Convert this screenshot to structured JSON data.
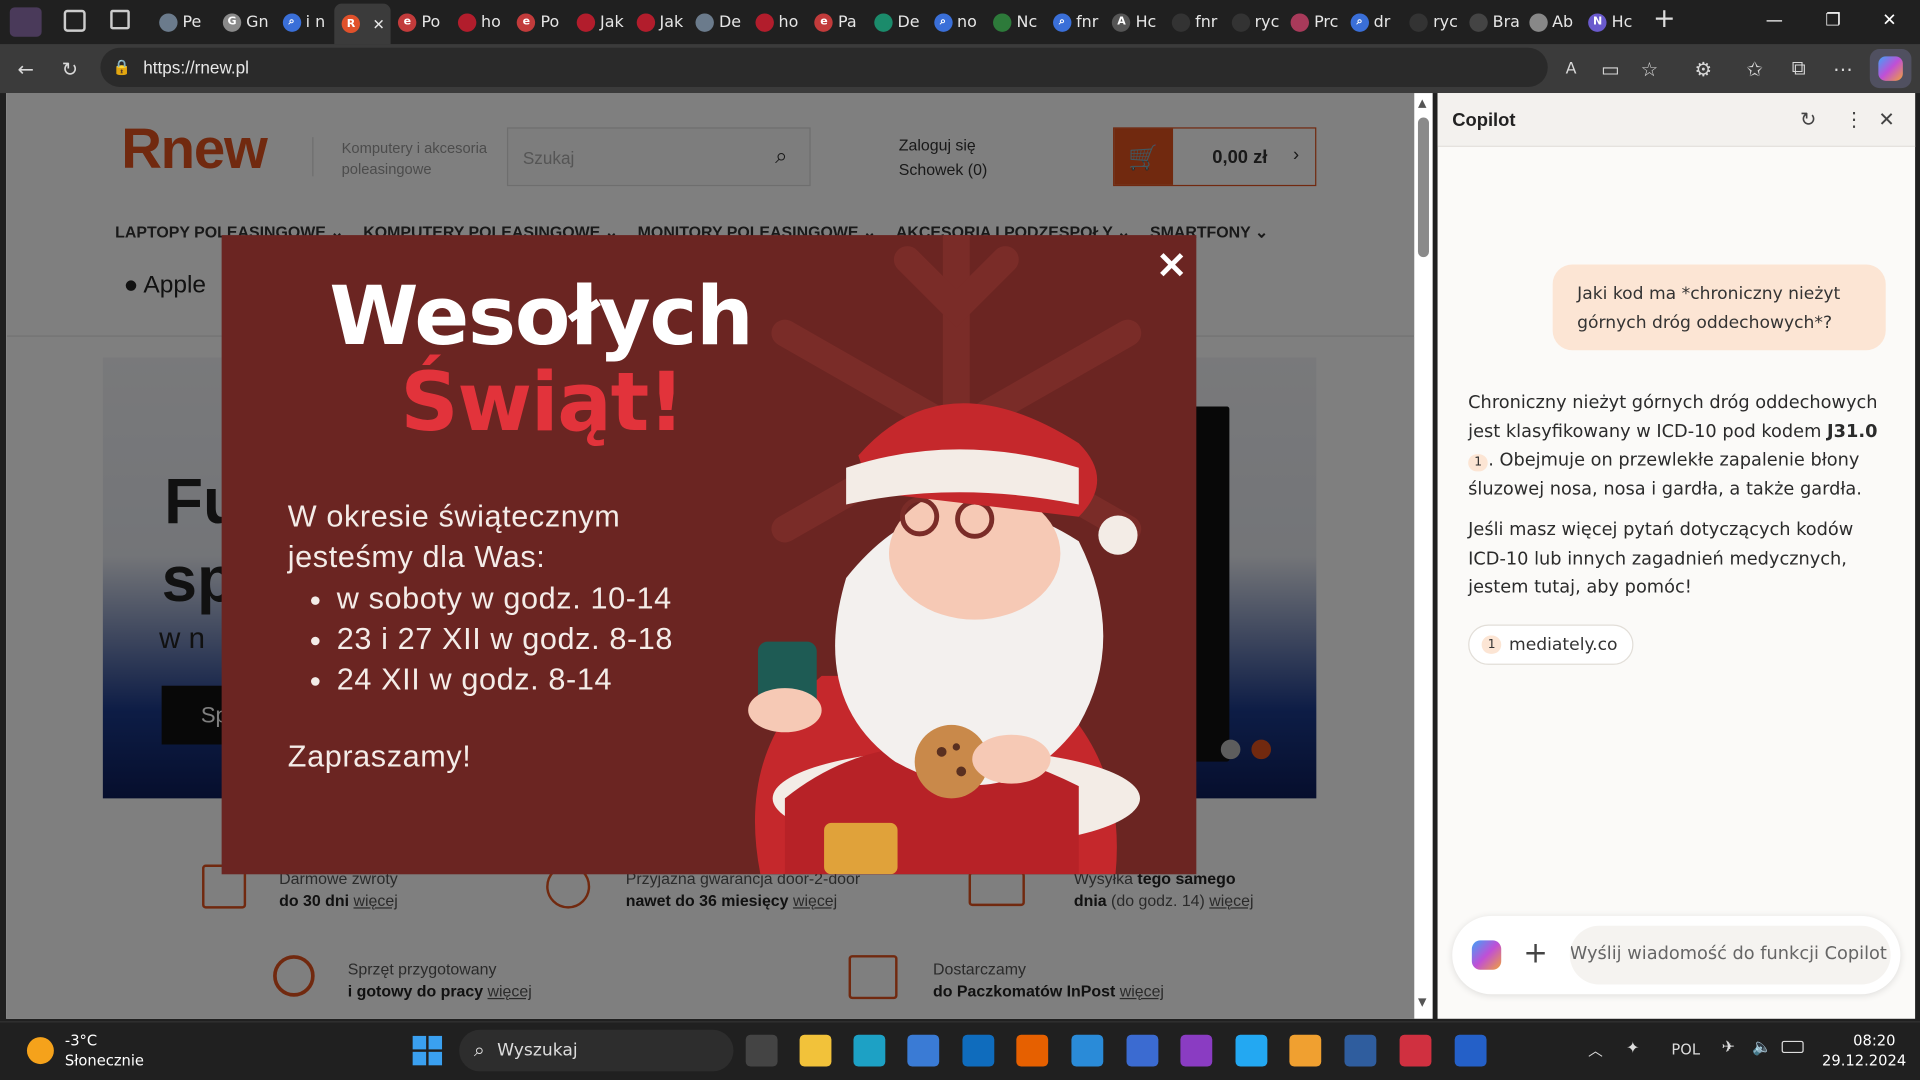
{
  "browser": {
    "tabs": [
      {
        "title": "Pe",
        "color": "#6b7b8c",
        "glyph": ""
      },
      {
        "title": "Gn",
        "color": "#8a8a8a",
        "glyph": "G"
      },
      {
        "title": "i n",
        "color": "#3a6fd8",
        "glyph": "⌕"
      },
      {
        "title": "",
        "color": "#e0512b",
        "glyph": "R",
        "active": true
      },
      {
        "title": "Po",
        "color": "#c23b3b",
        "glyph": "e"
      },
      {
        "title": "ho",
        "color": "#b21d2c",
        "glyph": ""
      },
      {
        "title": "Po",
        "color": "#c23b3b",
        "glyph": "e"
      },
      {
        "title": "Jak",
        "color": "#b21d2c",
        "glyph": ""
      },
      {
        "title": "Jak",
        "color": "#b21d2c",
        "glyph": ""
      },
      {
        "title": "De",
        "color": "#6b7b8c",
        "glyph": ""
      },
      {
        "title": "ho",
        "color": "#b21d2c",
        "glyph": ""
      },
      {
        "title": "Pa",
        "color": "#c23b3b",
        "glyph": "e"
      },
      {
        "title": "De",
        "color": "#1b8b6b",
        "glyph": ""
      },
      {
        "title": "no",
        "color": "#3a6fd8",
        "glyph": "⌕"
      },
      {
        "title": "Nc",
        "color": "#2d7a3a",
        "glyph": ""
      },
      {
        "title": "fnr",
        "color": "#3a6fd8",
        "glyph": "⌕"
      },
      {
        "title": "Hc",
        "color": "#555555",
        "glyph": "A"
      },
      {
        "title": "fnr",
        "color": "#333333",
        "glyph": ""
      },
      {
        "title": "ryc",
        "color": "#333333",
        "glyph": ""
      },
      {
        "title": "Prc",
        "color": "#a83a5a",
        "glyph": ""
      },
      {
        "title": "dr",
        "color": "#3a6fd8",
        "glyph": "⌕"
      },
      {
        "title": "ryc",
        "color": "#333333",
        "glyph": ""
      },
      {
        "title": "Bra",
        "color": "#444444",
        "glyph": ""
      },
      {
        "title": "Ab",
        "color": "#888888",
        "glyph": ""
      },
      {
        "title": "Hc",
        "color": "#6a5acd",
        "glyph": "N"
      }
    ],
    "url": "https://rnew.pl"
  },
  "site": {
    "logo": "Rnew",
    "tagline_1": "Komputery i akcesoria",
    "tagline_2": "poleasingowe",
    "search_placeholder": "Szukaj",
    "login": "Zaloguj się",
    "clipboard": "Schowek (0)",
    "cart_total": "0,00 zł",
    "nav": [
      "LAPTOPY POLEASINGOWE",
      "KOMPUTERY POLEASINGOWE",
      "MONITORY POLEASINGOWE",
      "AKCESORIA I PODZESPOŁY",
      "SMARTFONY"
    ],
    "brand": "Apple",
    "banner_text_1": "Fu",
    "banner_text_2": "sp",
    "banner_text_3": "w n",
    "banner_button": "Sp",
    "features": [
      {
        "line1": "Darmowe zwroty",
        "line2_bold": "do 30 dni",
        "link": "więcej"
      },
      {
        "line1": "Przyjazna gwarancja door-2-door",
        "line2_bold": "nawet do 36 miesięcy",
        "link": "więcej"
      },
      {
        "line1_pre": "Wysyłka ",
        "line1_bold": "tego samego",
        "line2_bold": "dnia",
        "line2": " (do godz. 14)",
        "link": "więcej"
      },
      {
        "line1": "Sprzęt przygotowany",
        "line2_bold": "i gotowy do pracy",
        "link": "więcej"
      },
      {
        "line1": "Dostarczamy",
        "line2_bold": "do Paczkomatów InPost",
        "link": "więcej"
      }
    ]
  },
  "popup": {
    "title_1": "Wesołych",
    "title_2": "Świąt!",
    "intro_1": "W okresie świątecznym",
    "intro_2": "jesteśmy dla Was:",
    "hours": [
      "w soboty w godz. 10-14",
      "23 i 27 XII w godz. 8-18",
      "24 XII w godz. 8-14"
    ],
    "closing": "Zapraszamy!",
    "close": "✕"
  },
  "copilot": {
    "title": "Copilot",
    "user_message": "Jaki kod ma *chroniczny nieżyt górnych dróg oddechowych*?",
    "answer_1_pre": "Chroniczny nieżyt górnych dróg oddechowych jest klasyfikowany w ICD-10 pod kodem ",
    "answer_1_code": "J31.0",
    "answer_1_cite": "1",
    "answer_1_post": "Obejmuje on przewlekłe zapalenie błony śluzowej nosa, nosa i gardła, a także gardła.",
    "answer_2": "Jeśli masz więcej pytań dotyczących kodów ICD-10 lub innych zagadnień medycznych, jestem tutaj, aby pomóc!",
    "source_num": "1",
    "source": "mediately.co",
    "input_placeholder": "Wyślij wiadomość do funkcji Copilot"
  },
  "taskbar": {
    "temp": "-3°C",
    "weather": "Słonecznie",
    "search": "Wyszukaj",
    "lang": "POL",
    "time": "08:20",
    "date": "29.12.2024",
    "apps": [
      {
        "name": "task-view",
        "color": "#444"
      },
      {
        "name": "file-explorer",
        "color": "#f2c23a"
      },
      {
        "name": "edge",
        "color": "#1da1c5"
      },
      {
        "name": "store",
        "color": "#3a7bd5"
      },
      {
        "name": "outlook",
        "color": "#0f6cbd"
      },
      {
        "name": "firefox",
        "color": "#e66000"
      },
      {
        "name": "photos",
        "color": "#2a8bd8"
      },
      {
        "name": "save",
        "color": "#3b6bd1"
      },
      {
        "name": "podcast",
        "color": "#8a3cc2"
      },
      {
        "name": "vscode",
        "color": "#23a8f2"
      },
      {
        "name": "media",
        "color": "#f0a030"
      },
      {
        "name": "virtualbox",
        "color": "#2f5d9e"
      },
      {
        "name": "davinci",
        "color": "#d03040"
      },
      {
        "name": "app-blue",
        "color": "#2460c8"
      }
    ]
  }
}
